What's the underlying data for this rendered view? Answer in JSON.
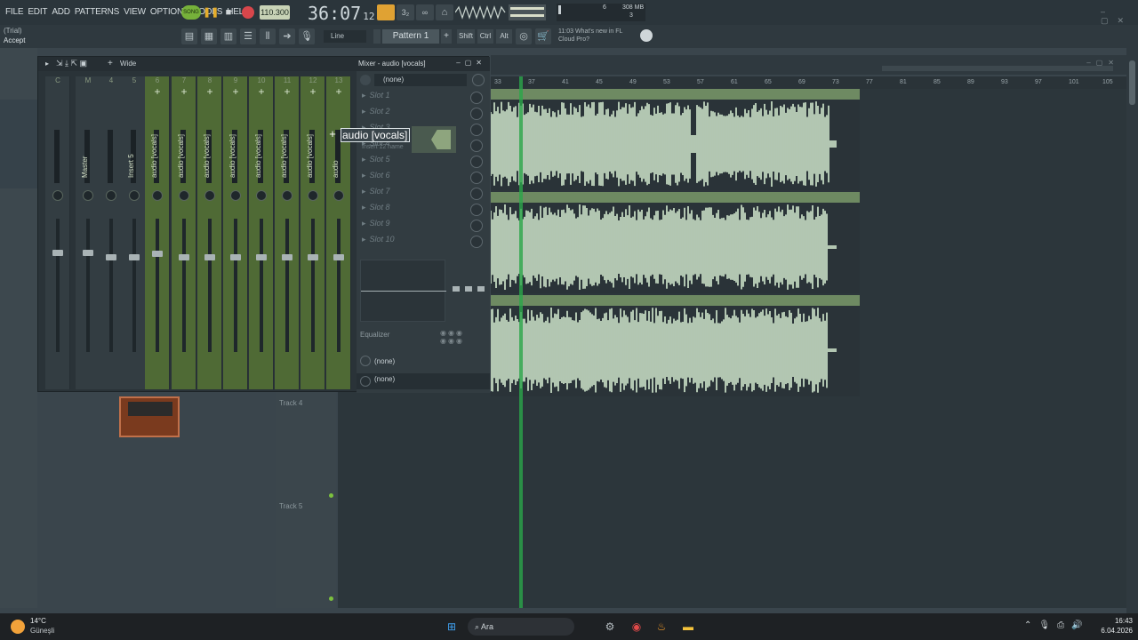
{
  "menu": [
    "FILE",
    "EDIT",
    "ADD",
    "PATTERNS",
    "VIEW",
    "OPTIONS",
    "TOOLS",
    "HELP"
  ],
  "transport": {
    "mode": "SONG",
    "tempo": "110.300",
    "time": "36:07",
    "time_sub": "12"
  },
  "cpu": {
    "value": "6",
    "mem": "308 MB",
    "voices": "3"
  },
  "hint": {
    "trial": "(Trial)",
    "action": "Accept"
  },
  "toolbar2": {
    "snap": "Line",
    "pattern": "Pattern 1",
    "shift": "Shift",
    "ctrl": "Ctrl",
    "alt": "Alt",
    "news_time": "11:03",
    "news": "What's new in FL Cloud Pro?"
  },
  "mixer": {
    "title": "Mixer - audio [vocals]",
    "mode": "Wide",
    "strips": [
      {
        "num": "C",
        "name": ""
      },
      {
        "num": "M",
        "name": "Master"
      },
      {
        "num": "4",
        "name": ""
      },
      {
        "num": "5",
        "name": "Insert 5"
      },
      {
        "num": "6",
        "name": "audio [vocals]"
      },
      {
        "num": "7",
        "name": "audio [vocals]"
      },
      {
        "num": "8",
        "name": "audio [vocals]"
      },
      {
        "num": "9",
        "name": "audio [vocals]"
      },
      {
        "num": "10",
        "name": "audio [vocals]"
      },
      {
        "num": "11",
        "name": "audio [vocals]"
      },
      {
        "num": "12",
        "name": "audio [vocals]"
      },
      {
        "num": "13",
        "name": "audio"
      }
    ],
    "input": "(none)",
    "slots": [
      "Slot 1",
      "Slot 2",
      "Slot 3",
      "Slot 4",
      "Slot 5",
      "Slot 6",
      "Slot 7",
      "Slot 8",
      "Slot 9",
      "Slot 10"
    ],
    "rename_value": "audio [vocals]",
    "rename_hint": "Insert 12 name",
    "equalizer": "Equalizer",
    "out1": "(none)",
    "out2": "(none)"
  },
  "playlist": {
    "ruler": [
      "33",
      "37",
      "41",
      "45",
      "49",
      "53",
      "57",
      "61",
      "65",
      "69",
      "73",
      "77",
      "81",
      "85",
      "89",
      "93",
      "97",
      "101",
      "105"
    ],
    "tracks": [
      "Track 4",
      "Track 5"
    ]
  },
  "taskbar": {
    "temp": "14°C",
    "weather": "Güneşli",
    "search": "Ara",
    "clock": "16:43",
    "date": "6.04.2026"
  }
}
